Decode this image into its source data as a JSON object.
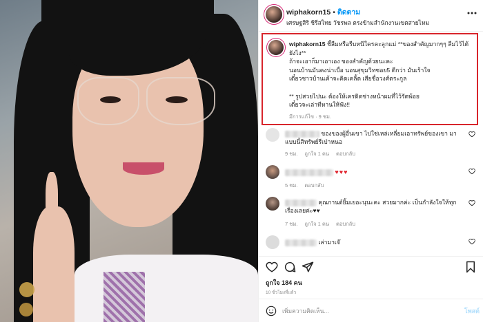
{
  "header": {
    "username": "wiphakorn15",
    "separator": "•",
    "follow_label": "ติดตาม",
    "location": "เศรษฐสิริ ชิรีสไทย วัชรพล ตรงข้ามสำนักงานเขตสายไหม"
  },
  "caption": {
    "username": "wiphakorn15",
    "lines": [
      "ชี้ลืมหรือรีบหนีใครคะลูกแม่ **ของสำคัญมากๆๆ ลืมไว้ได้",
      "ยังไง**",
      "ถ้าจะเอาก็มาเอาเอง ของสำคัญด้วยนะคะ",
      "นอนบ้านมันคงน่าเบื่อ นอนสุขุมวิทซอย5 ดีกว่า มันเร้าใจ",
      "เดี๋ยวชาวบ้านเค้าจะคิดเคลิ้ด เสียชื่อวงศ์ตระกูล",
      "",
      "** รูปสวยไปนะ ต้องให้เครดิตช่างหน้าผมที่ไว้รัดพ้อย",
      "เดี๋ยวจะเล่าทีหานให้ฟัง!!"
    ],
    "meta": "มีการแก้ไข · 9 ชม."
  },
  "comments": [
    {
      "text": "ของของผู้อื่นเขา ไปใช่เหล่เหลี่ยมเอาทรัพย์ของเขา มา แบบนี้สิทรัพย์รีเป่าหนอ",
      "time": "9 ชม.",
      "likes": "ถูกใจ 1 คน",
      "reply": "ตอบกลับ"
    },
    {
      "text": "♥♥♥",
      "time": "5 ชม.",
      "likes": "",
      "reply": "ตอบกลับ"
    },
    {
      "text": "คุณกานต์ยิ้มเยอะนุนะคะ สวยมากค่ะ เป็นกำลังใจให้ทุกเรื่องเลยค่ะ♥♥",
      "time": "7 ชม.",
      "likes": "ถูกใจ 1 คน",
      "reply": "ตอบกลับ"
    },
    {
      "text": "เล่ามาเจ๊",
      "time": "",
      "likes": "",
      "reply": ""
    }
  ],
  "stats": {
    "likes": "ถูกใจ 184 คน",
    "date": "10 ชั่วโมงที่แล้ว"
  },
  "composer": {
    "placeholder": "เพิ่มความคิดเห็น...",
    "post_label": "โพสต์"
  },
  "colors": {
    "accent": "#0095f6",
    "highlight_border": "#d8252b",
    "heart_red": "#e0242e"
  },
  "icons": [
    "heart-icon",
    "comment-icon",
    "share-icon",
    "bookmark-icon",
    "emoji-icon",
    "more-icon"
  ]
}
